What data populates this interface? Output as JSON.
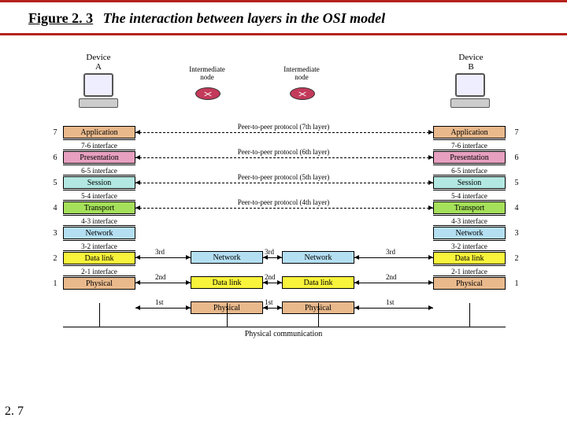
{
  "figure_label": "Figure 2. 3",
  "figure_title": "The interaction between layers in the OSI model",
  "page_number": "2. 7",
  "devices": {
    "a": {
      "name": "Device",
      "sub": "A"
    },
    "b": {
      "name": "Device",
      "sub": "B"
    },
    "n1": "Intermediate\nnode",
    "n2": "Intermediate\nnode"
  },
  "layers": [
    {
      "num": "7",
      "name": "Application",
      "iface": "7-6 interface",
      "cls": "c-app"
    },
    {
      "num": "6",
      "name": "Presentation",
      "iface": "6-5 interface",
      "cls": "c-pres"
    },
    {
      "num": "5",
      "name": "Session",
      "iface": "5-4 interface",
      "cls": "c-sess"
    },
    {
      "num": "4",
      "name": "Transport",
      "iface": "4-3 interface",
      "cls": "c-tran"
    },
    {
      "num": "3",
      "name": "Network",
      "iface": "3-2 interface",
      "cls": "c-net"
    },
    {
      "num": "2",
      "name": "Data link",
      "iface": "2-1 interface",
      "cls": "c-dl"
    },
    {
      "num": "1",
      "name": "Physical",
      "iface": null,
      "cls": "c-phy"
    }
  ],
  "node_layers": [
    {
      "name": "Network",
      "cls": "c-net"
    },
    {
      "name": "Data link",
      "cls": "c-dl"
    },
    {
      "name": "Physical",
      "cls": "c-phy"
    }
  ],
  "peer_labels": [
    "Peer-to-peer protocol (7th layer)",
    "Peer-to-peer protocol (6th layer)",
    "Peer-to-peer protocol (5th layer)",
    "Peer-to-peer protocol (4th layer)"
  ],
  "hop_labels": [
    "3rd",
    "2nd",
    "1st"
  ],
  "physical_comm": "Physical communication"
}
